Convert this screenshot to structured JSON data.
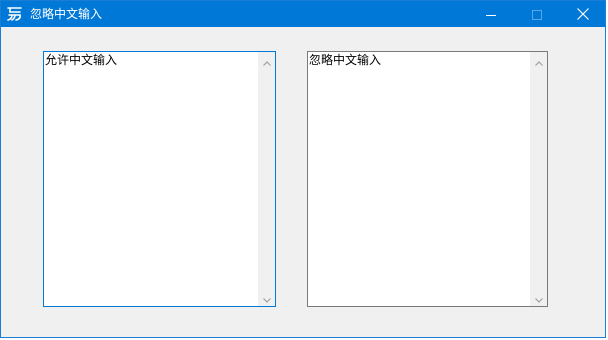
{
  "window": {
    "title": "忽略中文输入",
    "icon": "app-logo-icon",
    "accent_color": "#0078d7",
    "controls": {
      "minimize_icon": "minimize-icon",
      "maximize_icon": "maximize-icon",
      "close_icon": "close-icon"
    }
  },
  "textboxes": {
    "left": {
      "value": "允许中文输入",
      "focused": true
    },
    "right": {
      "value": "忽略中文输入",
      "focused": false
    }
  }
}
